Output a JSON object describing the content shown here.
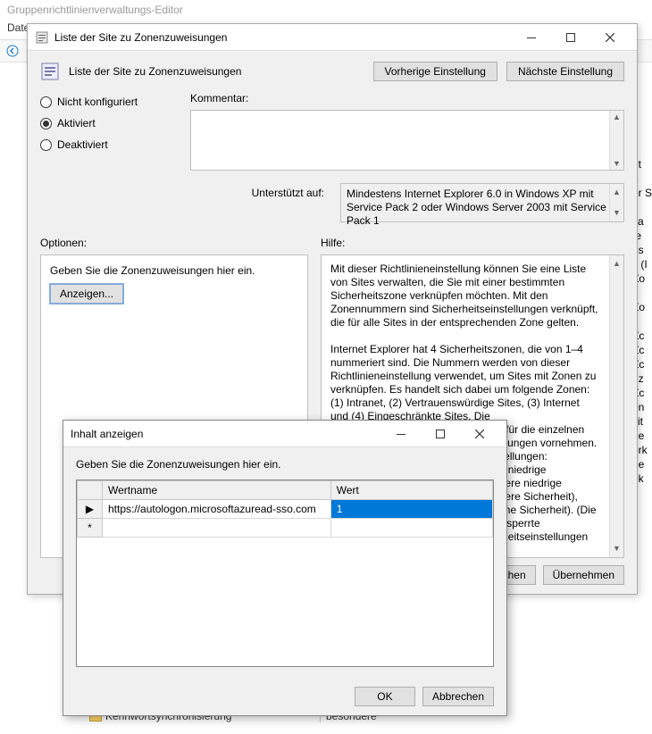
{
  "parent": {
    "title": "Gruppenrichtlinienverwaltungs-Editor",
    "menu_file": "Datei"
  },
  "dialog": {
    "window_title": "Liste der Site zu Zonenzuweisungen",
    "policy_title": "Liste der Site zu Zonenzuweisungen",
    "prev_btn": "Vorherige Einstellung",
    "next_btn": "Nächste Einstellung",
    "state": {
      "not_configured": "Nicht konfiguriert",
      "enabled": "Aktiviert",
      "disabled": "Deaktiviert",
      "selected": "enabled"
    },
    "comment_label": "Kommentar:",
    "comment_value": "",
    "supported_label": "Unterstützt auf:",
    "supported_value": "Mindestens Internet Explorer 6.0 in Windows XP mit Service Pack 2 oder Windows Server 2003 mit Service Pack 1",
    "options_label": "Optionen:",
    "help_label": "Hilfe:",
    "options_instruction": "Geben Sie die Zonenzuweisungen hier ein.",
    "show_btn": "Anzeigen...",
    "help_text": "Mit dieser Richtlinieneinstellung können Sie eine Liste von Sites verwalten, die Sie mit einer bestimmten Sicherheitszone verknüpfen möchten. Mit den Zonennummern sind Sicherheitseinstellungen verknüpft, die für alle Sites in der entsprechenden Zone gelten.\n\nInternet Explorer hat 4 Sicherheitszonen, die von 1–4 nummeriert sind. Die Nummern werden von dieser Richtlinieneinstellung verwendet, um Sites mit Zonen zu verknüpfen. Es handelt sich dabei um folgende Zonen: (1) Intranet, (2) Vertrauenswürdige Sites, (3) Internet und (4) Eingeschränkte Sites. Die Sicherheitseinstellungen lassen sich für die einzelnen Zonen über andere Richtlinieneinstellungen vornehmen. Dabei gelten folgende Standardeinstellungen: Vertrauenswürdige Sites (Vorlage für niedrige Sicherheit), Intranet (Vorlage für mittlere niedrige Sicherheit), Internet (Vorlage für mittlere Sicherheit), Eingeschränkte Sites (Vorlage für hohe Sicherheit). (Die Zone \"Lokaler Computer\" und das gesperrte Gegenstück weisen spezielle Sicherheitseinstellungen auf, die Ihren lokalen",
    "footer": {
      "ok": "OK",
      "cancel": "Abbrechen",
      "apply": "Übernehmen"
    }
  },
  "grid_dialog": {
    "title": "Inhalt anzeigen",
    "instruction": "Geben Sie die Zonenzuweisungen hier ein.",
    "col_name": "Wertname",
    "col_value": "Wert",
    "rows": [
      {
        "marker": "▶",
        "name": "https://autologon.microsoftazuread-sso.com",
        "value": "1",
        "selected": true
      },
      {
        "marker": "*",
        "name": "",
        "value": "",
        "selected": false
      }
    ],
    "ok": "OK",
    "cancel": "Abbrechen"
  },
  "tree_peek": {
    "item1": "Kennwortsynchronisierung",
    "right1": "besondere"
  },
  "bg_fragments": "\nnt\ne\ner S\n\nka\nte\nns\ns (I\nZo\n\nZo\n\nZc\nZc\nZc\nhz\nZc\nen\nsit\nne\nerk\nde\nok"
}
